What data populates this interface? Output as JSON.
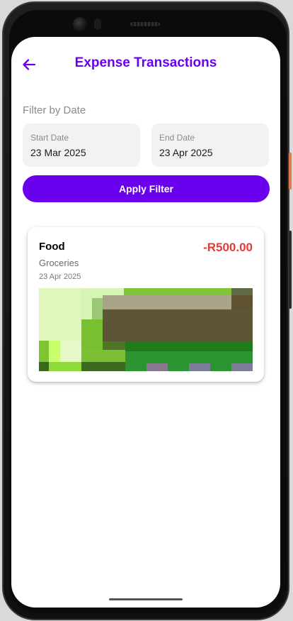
{
  "header": {
    "title": "Expense Transactions",
    "back_icon": "arrow-left-icon"
  },
  "filter": {
    "label": "Filter by Date",
    "start_date": {
      "caption": "Start Date",
      "value": "23 Mar 2025"
    },
    "end_date": {
      "caption": "End Date",
      "value": "23 Apr 2025"
    },
    "apply_label": "Apply Filter"
  },
  "transactions": [
    {
      "category": "Food",
      "amount": "-R500.00",
      "description": "Groceries",
      "date": "23 Apr 2025",
      "image": "receipt-photo"
    }
  ],
  "colors": {
    "accent": "#6a00ee",
    "expense_amount": "#e53935",
    "date_box_bg": "#f2f2f2",
    "muted_text": "#8a8a8a"
  }
}
